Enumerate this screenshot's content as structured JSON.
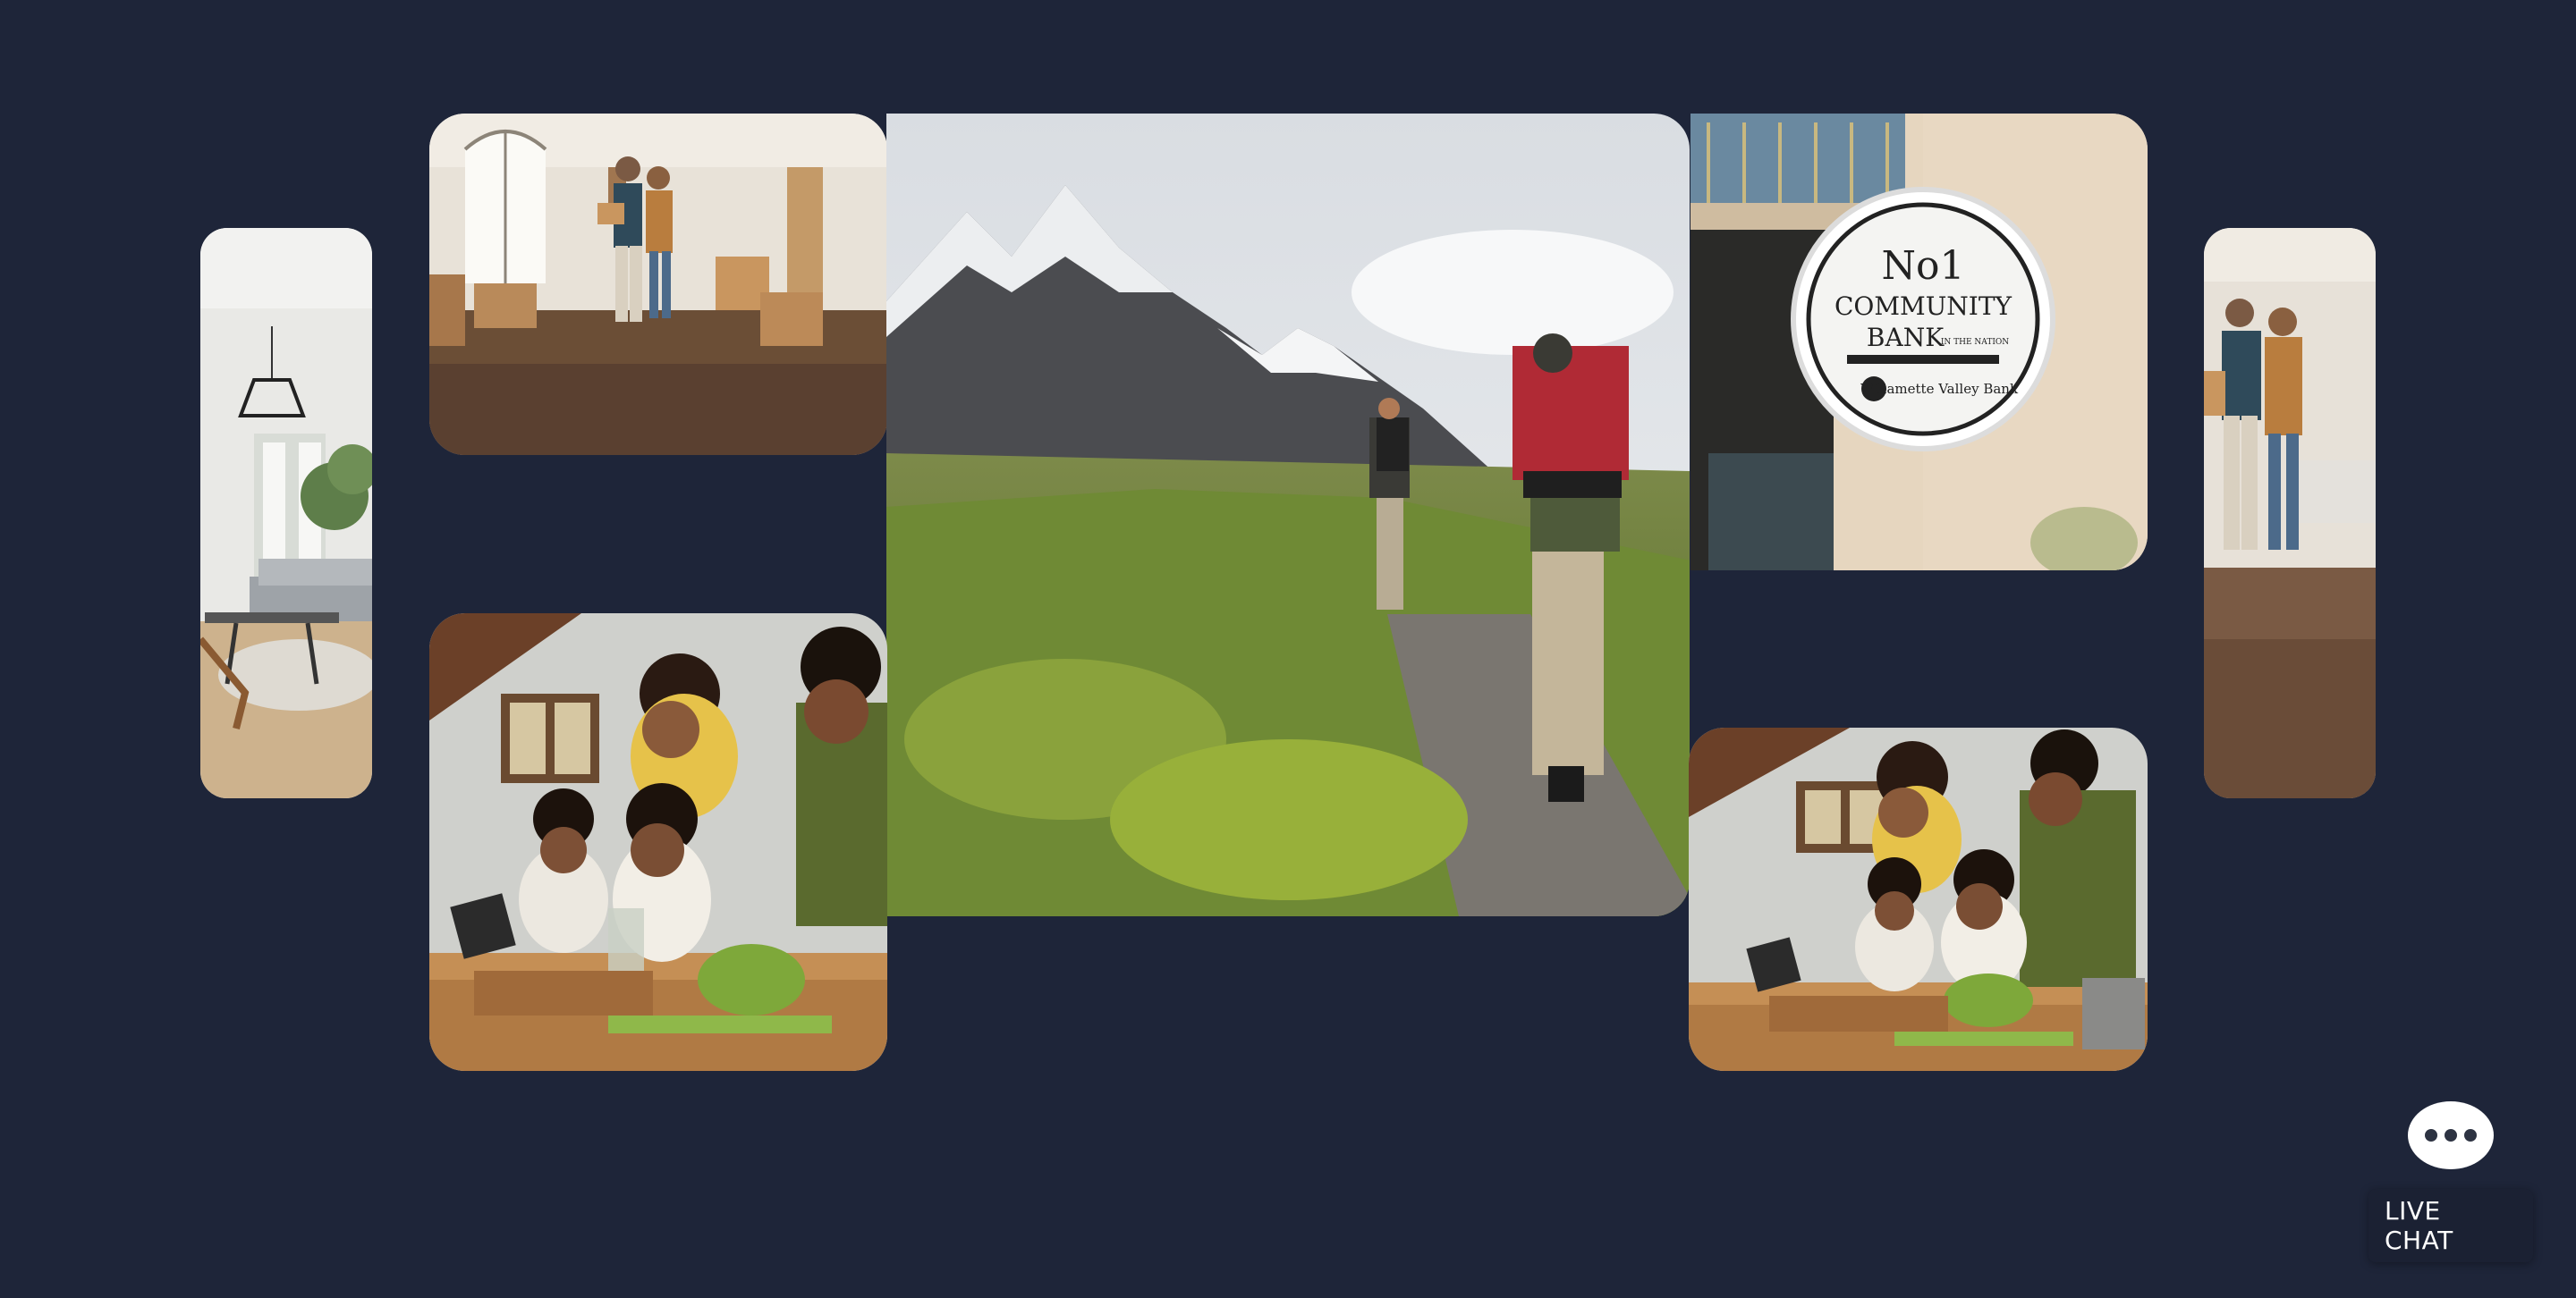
{
  "gallery": {
    "tiles": [
      {
        "id": "living",
        "subject": "bright living room with chandelier and sofa"
      },
      {
        "id": "moving",
        "subject": "couple standing among moving boxes in new home"
      },
      {
        "id": "hike",
        "subject": "two hikers walking toward snowy mountains"
      },
      {
        "id": "family1",
        "subject": "family preparing vegetables in kitchen"
      },
      {
        "id": "bank",
        "subject": "round community bank sign"
      },
      {
        "id": "family2",
        "subject": "family preparing vegetables in kitchen"
      },
      {
        "id": "couple",
        "subject": "couple standing in new home"
      }
    ],
    "bank_sign": {
      "line1": "No1",
      "line2": "COMMUNITY",
      "line3": "BANK",
      "line3_small": "IN THE NATION",
      "brand": "Willamette Valley Bank"
    }
  },
  "chat": {
    "icon": "more-dots-icon",
    "label": "LIVE CHAT"
  },
  "colors": {
    "background": "#1e2539",
    "chat_button": "#ffffff"
  }
}
